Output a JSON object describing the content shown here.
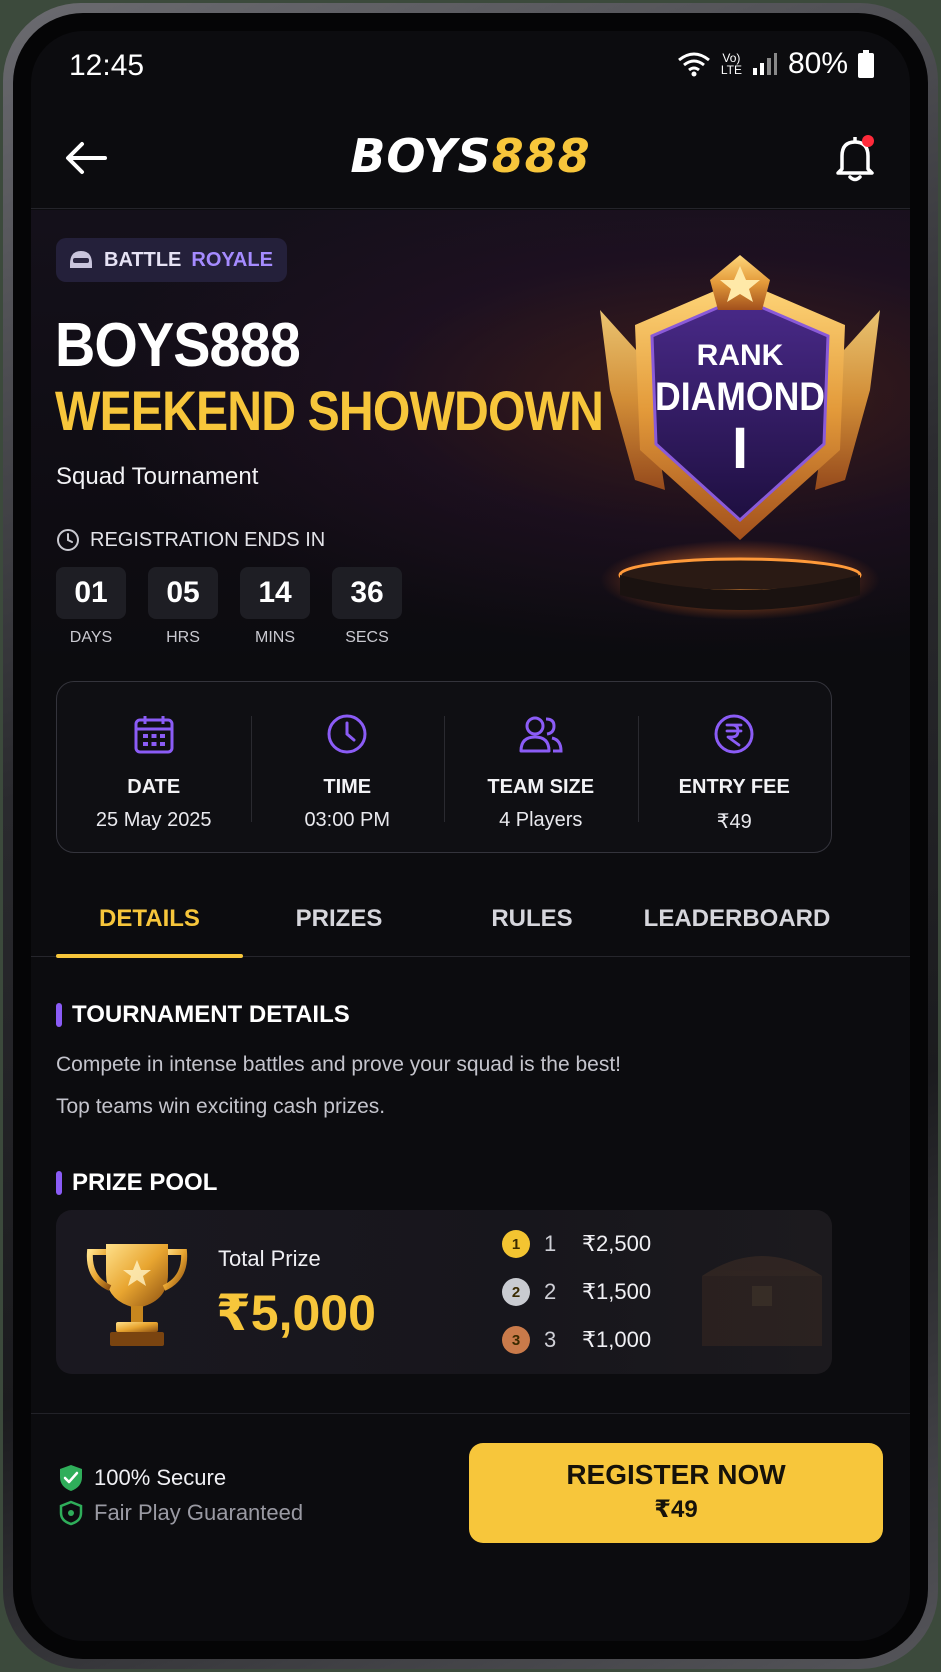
{
  "status_bar": {
    "time": "12:45",
    "lte_top": "Vo)",
    "lte_bottom": "LTE",
    "battery": "80%"
  },
  "header": {
    "brand_white": "BOYS",
    "brand_gold": "888"
  },
  "hero": {
    "mode_badge_1": "BATTLE",
    "mode_badge_2": "ROYALE",
    "title_line1": "BOYS888",
    "title_line2": "WEEKEND SHOWDOWN",
    "subtitle": "Squad Tournament",
    "registration_label": "REGISTRATION ENDS IN",
    "countdown": [
      {
        "value": "01",
        "label": "DAYS"
      },
      {
        "value": "05",
        "label": "HRS"
      },
      {
        "value": "14",
        "label": "MINS"
      },
      {
        "value": "36",
        "label": "SECS"
      }
    ],
    "rank": {
      "line1": "RANK",
      "line2": "DIAMOND",
      "line3": "I"
    }
  },
  "info": [
    {
      "icon": "calendar-icon",
      "label": "DATE",
      "value": "25 May 2025"
    },
    {
      "icon": "clock-icon",
      "label": "TIME",
      "value": "03:00 PM"
    },
    {
      "icon": "users-icon",
      "label": "TEAM SIZE",
      "value": "4 Players"
    },
    {
      "icon": "rupee-icon",
      "label": "ENTRY FEE",
      "value": "₹49"
    }
  ],
  "tabs": [
    {
      "label": "DETAILS",
      "active": true
    },
    {
      "label": "PRIZES",
      "active": false
    },
    {
      "label": "RULES",
      "active": false
    },
    {
      "label": "LEADERBOARD",
      "active": false
    }
  ],
  "details": {
    "heading": "TOURNAMENT DETAILS",
    "line1": "Compete in intense battles and prove your squad is the best!",
    "line2": "Top teams win exciting cash prizes."
  },
  "prize_pool": {
    "heading": "PRIZE POOL",
    "total_label": "Total Prize",
    "total_value": "₹5,000",
    "places": [
      {
        "medal": "1",
        "place": "1",
        "amount": "₹2,500",
        "color": "#f3c431"
      },
      {
        "medal": "2",
        "place": "2",
        "amount": "₹1,500",
        "color": "#c9cbd1"
      },
      {
        "medal": "3",
        "place": "3",
        "amount": "₹1,000",
        "color": "#c97a4a"
      }
    ]
  },
  "footer": {
    "secure": "100% Secure",
    "fair_play": "Fair Play Guaranteed",
    "register_label": "REGISTER NOW",
    "register_fee": "₹49"
  },
  "colors": {
    "accent_gold": "#f7c63b",
    "accent_purple": "#8b5cf6",
    "background": "#0c0c0f"
  }
}
